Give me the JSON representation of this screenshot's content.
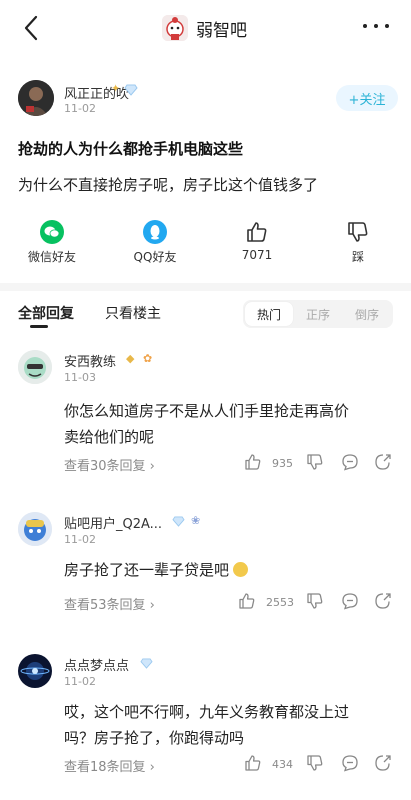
{
  "header": {
    "back_icon": "chevron-left-icon",
    "forum_name": "弱智吧",
    "more_icon": "more-dots-icon"
  },
  "post": {
    "author_name": "风正正的吹",
    "date": "11-02",
    "follow_label": "+关注",
    "title": "抢劫的人为什么都抢手机电脑这些",
    "body": "为什么不直接抢房子呢，房子比这个值钱多了"
  },
  "actions": {
    "wechat_label": "微信好友",
    "qq_label": "QQ好友",
    "like_count": "7071",
    "dislike_label": "踩"
  },
  "tabs": {
    "all_label": "全部回复",
    "op_label": "只看楼主",
    "sort_hot": "热门",
    "sort_asc": "正序",
    "sort_desc": "倒序"
  },
  "comments": [
    {
      "name": "安西教练",
      "date": "11-03",
      "line1": "你怎么知道房子不是从人们手里抢走再高价",
      "line2": "卖给他们的呢",
      "replies": "查看30条回复",
      "likes": "935"
    },
    {
      "name": "贴吧用户_Q2A...",
      "date": "11-02",
      "line1": "房子抢了还一辈子贷是吧",
      "replies": "查看53条回复",
      "likes": "2553"
    },
    {
      "name": "点点梦点点",
      "date": "11-02",
      "line1": "哎，这个吧不行啊，九年义务教育都没上过",
      "line2": "吗？房子抢了，你跑得动吗",
      "replies": "查看18条回复",
      "likes": "434"
    }
  ],
  "colors": {
    "accent": "#2bb3d6",
    "wechat": "#07c160",
    "qq": "#22a8f0"
  }
}
